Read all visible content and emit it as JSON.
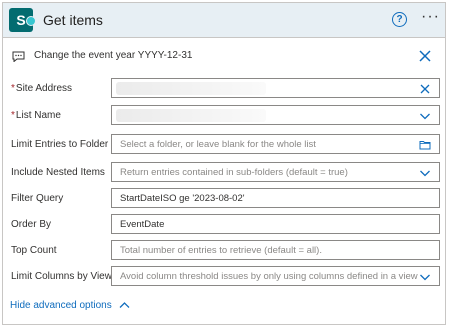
{
  "header": {
    "title": "Get items",
    "logo_letter": "S"
  },
  "note": {
    "text": "Change the event year YYYY-12-31"
  },
  "fields": [
    {
      "label": "Site Address",
      "required": "*",
      "value": "",
      "placeholder": ""
    },
    {
      "label": "List Name",
      "required": "*",
      "value": "",
      "placeholder": ""
    },
    {
      "label": "Limit Entries to Folder",
      "value": "",
      "placeholder": "Select a folder, or leave blank for the whole list"
    },
    {
      "label": "Include Nested Items",
      "value": "",
      "placeholder": "Return entries contained in sub-folders (default = true)"
    },
    {
      "label": "Filter Query",
      "value": "StartDateISO ge '2023-08-02'",
      "placeholder": ""
    },
    {
      "label": "Order By",
      "value": "EventDate",
      "placeholder": ""
    },
    {
      "label": "Top Count",
      "value": "",
      "placeholder": "Total number of entries to retrieve (default = all)."
    },
    {
      "label": "Limit Columns by View",
      "value": "",
      "placeholder": "Avoid column threshold issues by only using columns defined in a view"
    }
  ],
  "footer": {
    "toggle_label": "Hide advanced options"
  },
  "colors": {
    "accent": "#0f6cbd",
    "header_bg": "#e7eff4",
    "sharepoint": "#036c70"
  }
}
